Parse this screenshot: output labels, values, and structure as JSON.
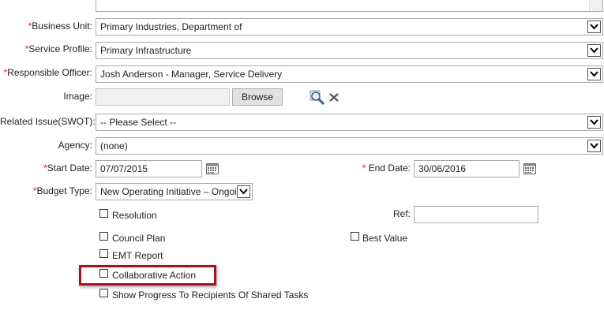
{
  "form": {
    "business_unit": {
      "label": "Business Unit:",
      "value": "Primary Industries, Department of",
      "required": true
    },
    "service_profile": {
      "label": "Service Profile:",
      "value": "Primary Infrastructure",
      "required": true
    },
    "responsible_officer": {
      "label": "Responsible Officer:",
      "value": "Josh Anderson - Manager, Service Delivery",
      "required": true
    },
    "image": {
      "label": "Image:",
      "value": "",
      "browse_label": "Browse"
    },
    "related_issue": {
      "label": "Related Issue(SWOT):",
      "value": "-- Please Select --"
    },
    "agency": {
      "label": "Agency:",
      "value": "(none)"
    },
    "start_date": {
      "label": "Start Date:",
      "value": "07/07/2015",
      "required": true
    },
    "end_date": {
      "label": "End Date:",
      "value": "30/06/2016",
      "required": true
    },
    "budget_type": {
      "label": "Budget Type:",
      "value": "New Operating Initiative – Ongoing",
      "required": true
    },
    "ref": {
      "label": "Ref:",
      "value": ""
    },
    "checkboxes": {
      "resolution": {
        "label": "Resolution",
        "checked": false
      },
      "council_plan": {
        "label": "Council Plan",
        "checked": false
      },
      "best_value": {
        "label": "Best Value",
        "checked": false
      },
      "emt_report": {
        "label": "EMT Report",
        "checked": false
      },
      "collaborative_action": {
        "label": "Collaborative Action",
        "checked": false
      },
      "show_progress": {
        "label": "Show Progress To Recipients Of Shared Tasks",
        "checked": false
      }
    },
    "required_marker": "*"
  },
  "colors": {
    "required": "#d21f1f",
    "highlight_border": "#a5141d",
    "field_border": "#a9a9a9",
    "disabled_field": "#f0f0f0"
  },
  "icons": {
    "image_preview": "magnifier-icon",
    "image_clear": "close-icon",
    "date_picker": "calendar-icon"
  }
}
